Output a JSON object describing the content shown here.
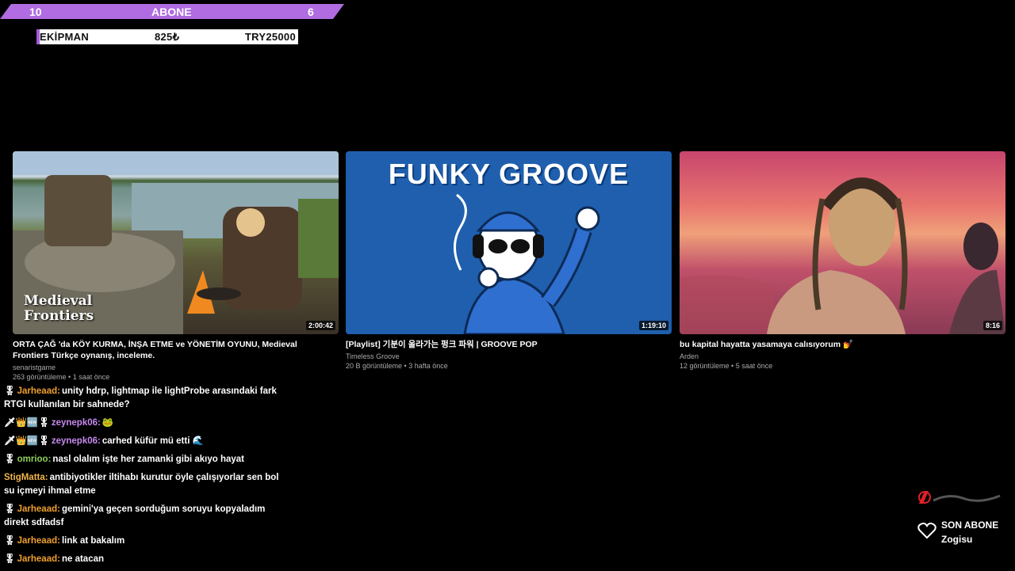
{
  "subscriber_bar": {
    "left_count": "10",
    "title": "ABONE",
    "right_count": "6"
  },
  "equipment": {
    "label": "EKİPMAN",
    "price": "825₺",
    "goal": "TRY25000",
    "progress_fraction": 0.01
  },
  "videos": [
    {
      "title": "ORTA ÇAĞ 'da KÖY KURMA, İNŞA ETME ve YÖNETİM OYUNU, Medieval Frontiers Türkçe oynanış, inceleme.",
      "channel": "senaristgame",
      "stats": "263 görüntüleme • 1 saat önce",
      "duration": "2:00:42",
      "overlay_logo": "Medieval Frontiers"
    },
    {
      "title": "[Playlist] 기분이 올라가는 펑크 파워 | GROOVE POP",
      "channel": "Timeless Groove",
      "stats": "20 B görüntüleme • 3 hafta önce",
      "duration": "1:19:10",
      "overlay_text": "FUNKY GROOVE"
    },
    {
      "title": "bu kapital hayatta yasamaya calısıyorum 💅",
      "channel": "Arden",
      "stats": "12 görüntüleme • 5 saat önce",
      "duration": "8:16"
    }
  ],
  "chat": [
    {
      "user": "Jarheaad:",
      "color": "#f0a030",
      "badges": "🎖",
      "text": "unity hdrp, lightmap ile lightProbe arasındaki fark RTGI kullanılan bir sahnede?"
    },
    {
      "user": "zeynepk06:",
      "color": "#c78af0",
      "badges": "🗡👑🆕🎖",
      "text": "🐸"
    },
    {
      "user": "zeynepk06:",
      "color": "#c78af0",
      "badges": "🗡👑🆕🎖",
      "text": "carhed küfür mü etti 🌊"
    },
    {
      "user": "omrioo:",
      "color": "#8ed05a",
      "badges": "🎖",
      "text": "nasl olalım işte her zamanki gibi akıyo hayat"
    },
    {
      "user": "StigMatta:",
      "color": "#f0b44a",
      "badges": "",
      "text": "antibiyotikler iltihabı kurutur öyle çalışıyorlar sen bol su içmeyi ihmal etme"
    },
    {
      "user": "Jarheaad:",
      "color": "#f0a030",
      "badges": "🎖",
      "text": "gemini'ya geçen sorduğum soruyu kopyaladım direkt sdfadsf"
    },
    {
      "user": "Jarheaad:",
      "color": "#f0a030",
      "badges": "🎖",
      "text": "link at bakalım"
    },
    {
      "user": "Jarheaad:",
      "color": "#f0a030",
      "badges": "🎖",
      "text": "ne atacan"
    }
  ],
  "last_subscriber": {
    "label": "SON ABONE",
    "name": "Zogisu"
  },
  "icons": {
    "heart": "heart-icon",
    "logo": "brand-logo"
  }
}
